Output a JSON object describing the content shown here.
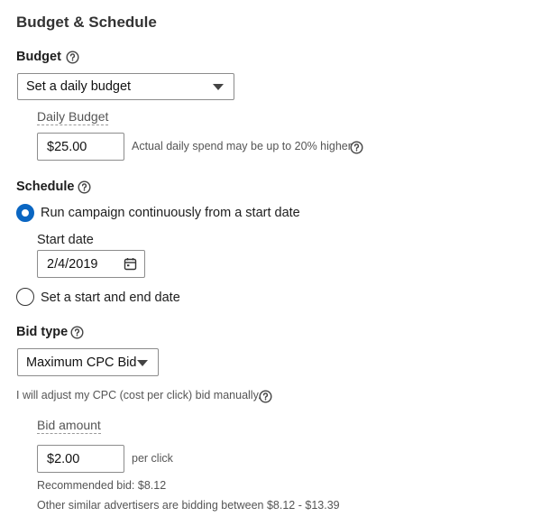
{
  "page": {
    "title": "Budget & Schedule"
  },
  "budget": {
    "label": "Budget",
    "select_value": "Set a daily budget",
    "daily_budget_label": "Daily Budget",
    "daily_budget_value": "$25.00",
    "daily_budget_hint": "Actual daily spend may be up to 20% higher"
  },
  "schedule": {
    "label": "Schedule",
    "option_continuous": "Run campaign continuously from a start date",
    "start_date_label": "Start date",
    "start_date_value": "2/4/2019",
    "option_start_end": "Set a start and end date"
  },
  "bid": {
    "label": "Bid type",
    "select_value": "Maximum CPC Bid",
    "note": "I will adjust my CPC (cost per click) bid manually.",
    "amount_label": "Bid amount",
    "amount_value": "$2.00",
    "per_click": "per click",
    "recommended": "Recommended bid: $8.12",
    "similar": "Other similar advertisers are bidding between $8.12 - $13.39"
  },
  "icons": {
    "help": "question-circle-icon",
    "calendar": "calendar-icon",
    "caret": "caret-down-icon"
  },
  "colors": {
    "accent": "#0a66c2"
  }
}
